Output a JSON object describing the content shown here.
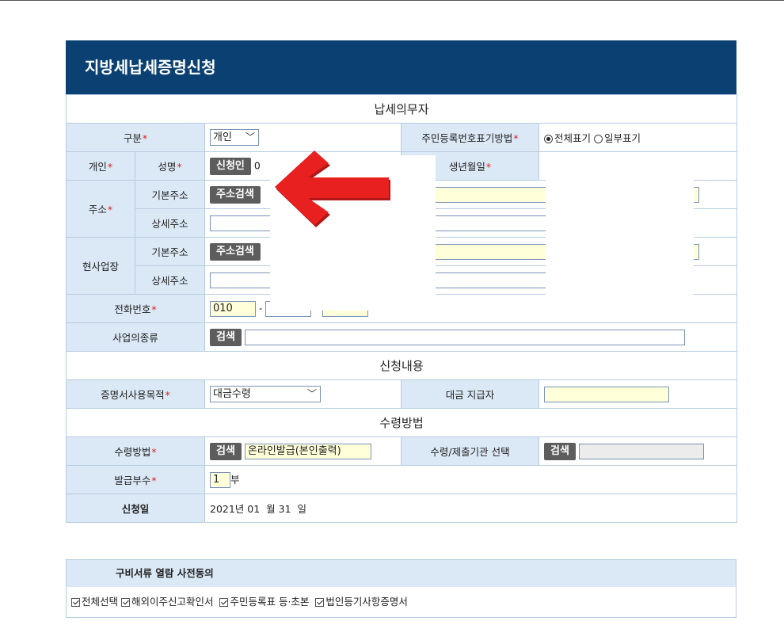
{
  "page_title": "지방세납세증명신청",
  "sections": {
    "taxpayer": "납세의무자",
    "request": "신청내용",
    "receipt": "수령방법"
  },
  "labels": {
    "category": "구분",
    "rrn_display": "주민등록번호표기방법",
    "individual": "개인",
    "name": "성명",
    "birthdate": "생년월일",
    "address": "주소",
    "basic_address": "기본주소",
    "detail_address": "상세주소",
    "business_site": "현사업장",
    "phone": "전화번호",
    "business_type": "사업의종류",
    "purpose": "증명서사용목적",
    "payee": "대금 지급자",
    "receipt_method": "수령방법",
    "receipt_agency": "수령/제출기관 선택",
    "copies": "발급부수",
    "apply_date": "신청일"
  },
  "controls": {
    "category_value": "개인",
    "rrn_full": "전체표기",
    "rrn_partial": "일부표기",
    "applicant_btn": "신청인",
    "applicant_partial": "0",
    "address_search": "주소검색",
    "phone_prefix": "010",
    "phone_sep": "-",
    "search": "검색",
    "purpose_value": "대금수령",
    "receipt_method_value": "온라인발급(본인출력)",
    "copies_value": "1",
    "copies_unit": "부",
    "apply_date_value": "2021년 01  월 31  일"
  },
  "consent": {
    "title": "구비서류 열람 사전동의",
    "items": [
      "전체선택",
      "해외이주신고확인서",
      "주민등록표 등·초본",
      "법인등기사항증명서"
    ]
  },
  "colors": {
    "header_bg": "#0b4172",
    "label_bg": "#dbe8f5",
    "border": "#b8cce0",
    "required": "#dd2222",
    "arrow": "#e82020"
  }
}
